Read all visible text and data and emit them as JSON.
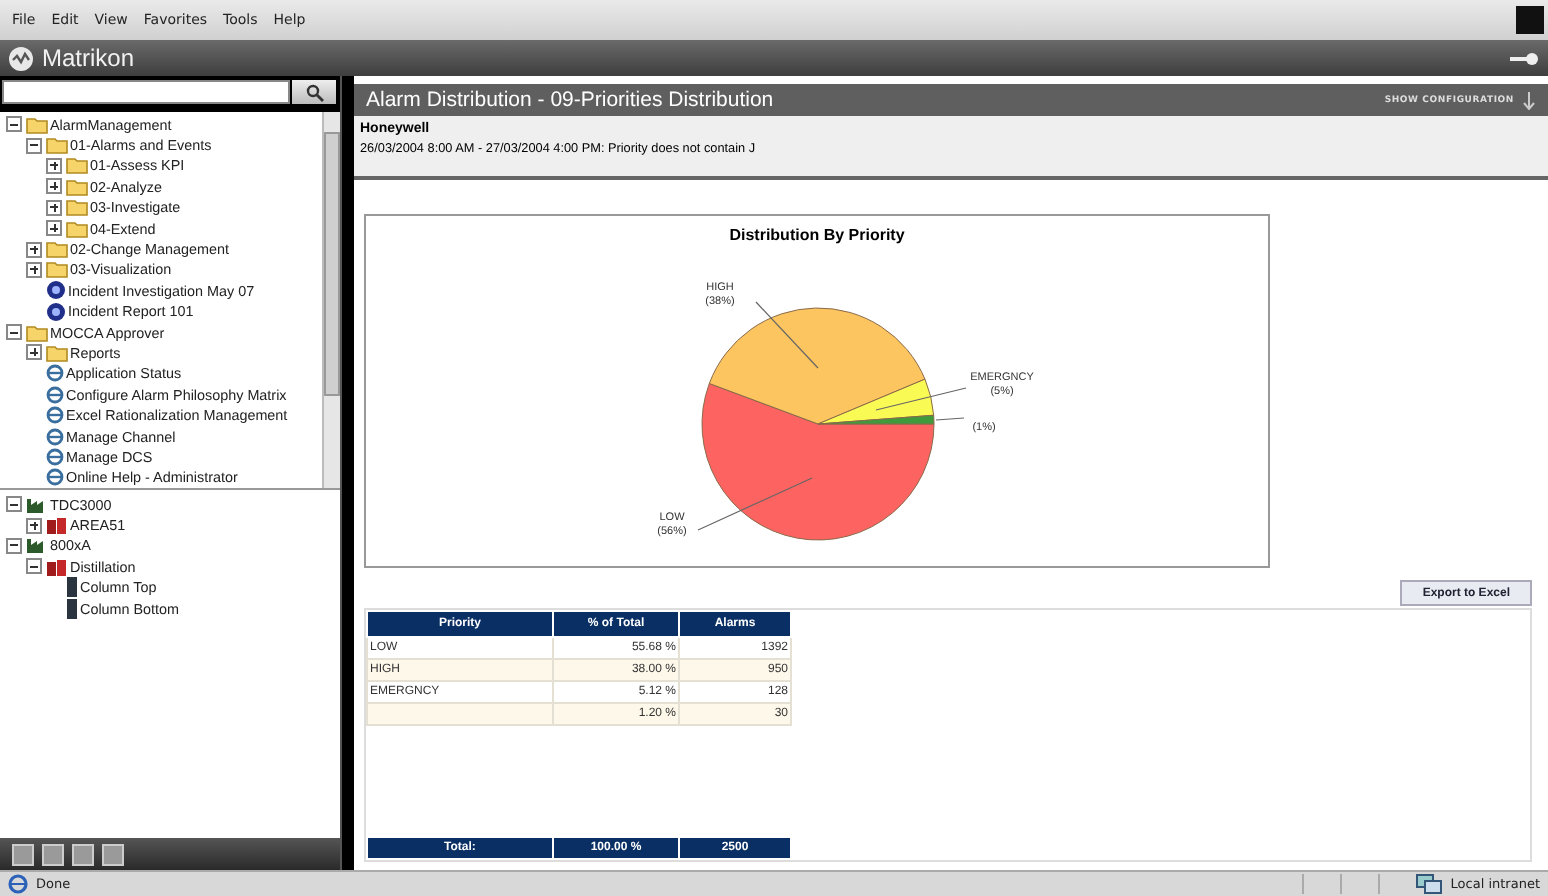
{
  "menu": [
    "File",
    "Edit",
    "View",
    "Favorites",
    "Tools",
    "Help"
  ],
  "brand": "Matrikon",
  "tree": [
    {
      "label": "AlarmManagement",
      "kind": "folder",
      "expanded": true,
      "children": [
        {
          "label": "01-Alarms and Events",
          "kind": "folder",
          "expanded": true,
          "children": [
            {
              "label": "01-Assess KPI",
              "kind": "folder",
              "expanded": false
            },
            {
              "label": "02-Analyze",
              "kind": "folder",
              "expanded": false
            },
            {
              "label": "03-Investigate",
              "kind": "folder",
              "expanded": false
            },
            {
              "label": "04-Extend",
              "kind": "folder",
              "expanded": false
            }
          ]
        },
        {
          "label": "02-Change Management",
          "kind": "folder",
          "expanded": false
        },
        {
          "label": "03-Visualization",
          "kind": "folder",
          "expanded": false
        },
        {
          "label": "Incident Investigation May 07",
          "kind": "report"
        },
        {
          "label": "Incident Report 101",
          "kind": "report"
        }
      ]
    },
    {
      "label": "MOCCA Approver",
      "kind": "folder",
      "expanded": true,
      "children": [
        {
          "label": "Reports",
          "kind": "folder",
          "expanded": false
        },
        {
          "label": "Application Status",
          "kind": "page"
        },
        {
          "label": "Configure Alarm Philosophy Matrix",
          "kind": "page"
        },
        {
          "label": "Excel Rationalization Management",
          "kind": "page"
        },
        {
          "label": "Manage Channel",
          "kind": "page"
        },
        {
          "label": "Manage DCS",
          "kind": "page"
        },
        {
          "label": "Online Help - Administrator",
          "kind": "page"
        }
      ]
    }
  ],
  "plant_tree": [
    {
      "label": "TDC3000",
      "kind": "plant",
      "expanded": true,
      "children": [
        {
          "label": "AREA51",
          "kind": "area",
          "expanded": false
        }
      ]
    },
    {
      "label": "800xA",
      "kind": "plant",
      "expanded": true,
      "children": [
        {
          "label": "Distillation",
          "kind": "area",
          "expanded": true,
          "children": [
            {
              "label": "Column Top",
              "kind": "tag"
            },
            {
              "label": "Column Bottom",
              "kind": "tag"
            }
          ]
        }
      ]
    }
  ],
  "report": {
    "title": "Alarm Distribution - 09-Priorities Distribution",
    "config_link": "SHOW CONFIGURATION",
    "company": "Honeywell",
    "filter": "26/03/2004 8:00 AM - 27/03/2004 4:00 PM: Priority does not contain J"
  },
  "chart_data": {
    "type": "pie",
    "title": "Distribution By Priority",
    "categories": [
      "LOW",
      "HIGH",
      "EMERGNCY",
      null
    ],
    "values": [
      55.68,
      38.0,
      5.12,
      1.2
    ],
    "value_labels": [
      "(56%)",
      "(38%)",
      "(5%)",
      "(1%)"
    ],
    "colors": [
      "#fd6461",
      "#fcc55f",
      "#fafa55",
      "#3f9a3c"
    ]
  },
  "export_button": "Export to Excel",
  "table": {
    "columns": [
      "Priority",
      "% of Total",
      "Alarms"
    ],
    "rows": [
      [
        "LOW",
        "55.68 %",
        "1392"
      ],
      [
        "HIGH",
        "38.00 %",
        "950"
      ],
      [
        "EMERGNCY",
        "5.12 %",
        "128"
      ],
      [
        "",
        "1.20 %",
        "30"
      ]
    ],
    "total": [
      "Total:",
      "100.00 %",
      "2500"
    ]
  },
  "status_bar": {
    "text": "Done",
    "zone": "Local intranet"
  }
}
